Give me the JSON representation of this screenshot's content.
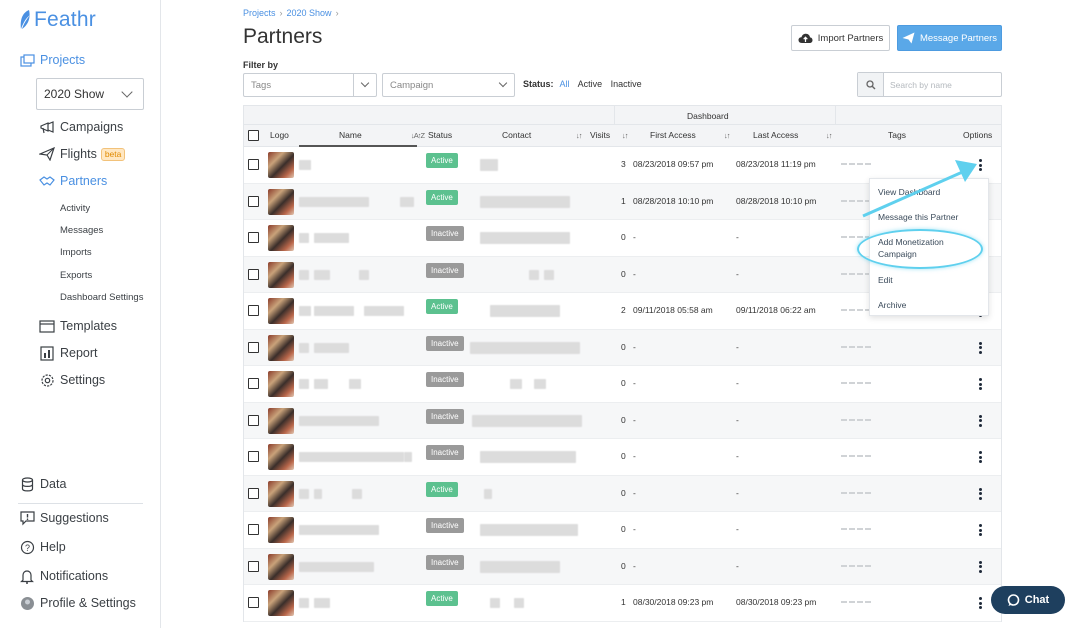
{
  "app": {
    "brand": "Feathr"
  },
  "sidebar": {
    "projects_label": "Projects",
    "project_select": "2020 Show",
    "campaigns_label": "Campaigns",
    "flights_label": "Flights",
    "flights_badge": "beta",
    "partners_label": "Partners",
    "partners_sub": [
      "Activity",
      "Messages",
      "Imports",
      "Exports",
      "Dashboard Settings"
    ],
    "templates_label": "Templates",
    "report_label": "Report",
    "settings_label": "Settings",
    "data_label": "Data",
    "suggestions_label": "Suggestions",
    "help_label": "Help",
    "notifications_label": "Notifications",
    "profile_label": "Profile & Settings"
  },
  "breadcrumb": [
    "Projects",
    "2020 Show"
  ],
  "page": {
    "title": "Partners",
    "import_button": "Import Partners",
    "message_button": "Message Partners",
    "filter_by": "Filter by",
    "tags_placeholder": "Tags",
    "campaign_placeholder": "Campaign",
    "status_label": "Status:",
    "status_options": [
      "All",
      "Active",
      "Inactive"
    ],
    "search_placeholder": "Search by name"
  },
  "table": {
    "group_header": "Dashboard",
    "columns": [
      "Logo",
      "Name",
      "Status",
      "Contact",
      "Visits",
      "First Access",
      "Last Access",
      "Tags",
      "Options"
    ],
    "rows": [
      {
        "status": "Active",
        "visits": "3",
        "first": "08/23/2018 09:57 pm",
        "last": "08/23/2018 11:19 pm"
      },
      {
        "status": "Active",
        "visits": "1",
        "first": "08/28/2018 10:10 pm",
        "last": "08/28/2018 10:10 pm"
      },
      {
        "status": "Inactive",
        "visits": "0",
        "first": "-",
        "last": "-"
      },
      {
        "status": "Inactive",
        "visits": "0",
        "first": "-",
        "last": "-"
      },
      {
        "status": "Active",
        "visits": "2",
        "first": "09/11/2018 05:58 am",
        "last": "09/11/2018 06:22 am"
      },
      {
        "status": "Inactive",
        "visits": "0",
        "first": "-",
        "last": "-"
      },
      {
        "status": "Inactive",
        "visits": "0",
        "first": "-",
        "last": "-"
      },
      {
        "status": "Inactive",
        "visits": "0",
        "first": "-",
        "last": "-"
      },
      {
        "status": "Inactive",
        "visits": "0",
        "first": "-",
        "last": "-"
      },
      {
        "status": "Active",
        "visits": "0",
        "first": "-",
        "last": "-"
      },
      {
        "status": "Inactive",
        "visits": "0",
        "first": "-",
        "last": "-"
      },
      {
        "status": "Inactive",
        "visits": "0",
        "first": "-",
        "last": "-"
      },
      {
        "status": "Active",
        "visits": "1",
        "first": "08/30/2018 09:23 pm",
        "last": "08/30/2018 09:23 pm"
      }
    ]
  },
  "menu": {
    "items": [
      "View Dashboard",
      "Message this Partner",
      "Add Monetization Campaign",
      "Edit",
      "Archive"
    ]
  },
  "chat": {
    "label": "Chat"
  },
  "colors": {
    "accent": "#4a90e2",
    "active": "#5cc18f",
    "inactive": "#9a9a9a",
    "highlight": "#5fd0ee",
    "chat": "#1e3f5e"
  }
}
